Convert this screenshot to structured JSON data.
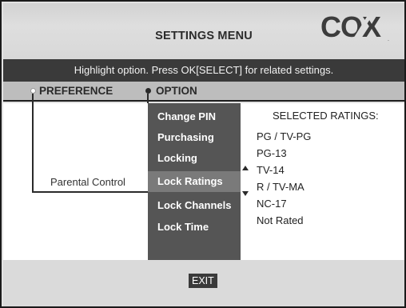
{
  "header": {
    "title": "SETTINGS MENU",
    "logo_text": "COX",
    "logo_dot": "."
  },
  "instruction": "Highlight option. Press OK[SELECT] for related settings.",
  "columns": {
    "preference": "PREFERENCE",
    "option": "OPTION"
  },
  "preference": {
    "selected": "Parental Control"
  },
  "options": [
    {
      "label": "Change PIN",
      "selected": false
    },
    {
      "label": "Purchasing",
      "selected": false
    },
    {
      "label": "Locking",
      "selected": false
    },
    {
      "label": "Lock Ratings",
      "selected": true
    },
    {
      "label": "Lock Channels",
      "selected": false
    },
    {
      "label": "Lock Time",
      "selected": false
    }
  ],
  "ratings": {
    "title": "SELECTED RATINGS:",
    "items": [
      "PG / TV-PG",
      "PG-13",
      "TV-14",
      "R / TV-MA",
      "NC-17",
      "Not Rated"
    ]
  },
  "footer": {
    "exit_label": "EXIT"
  }
}
